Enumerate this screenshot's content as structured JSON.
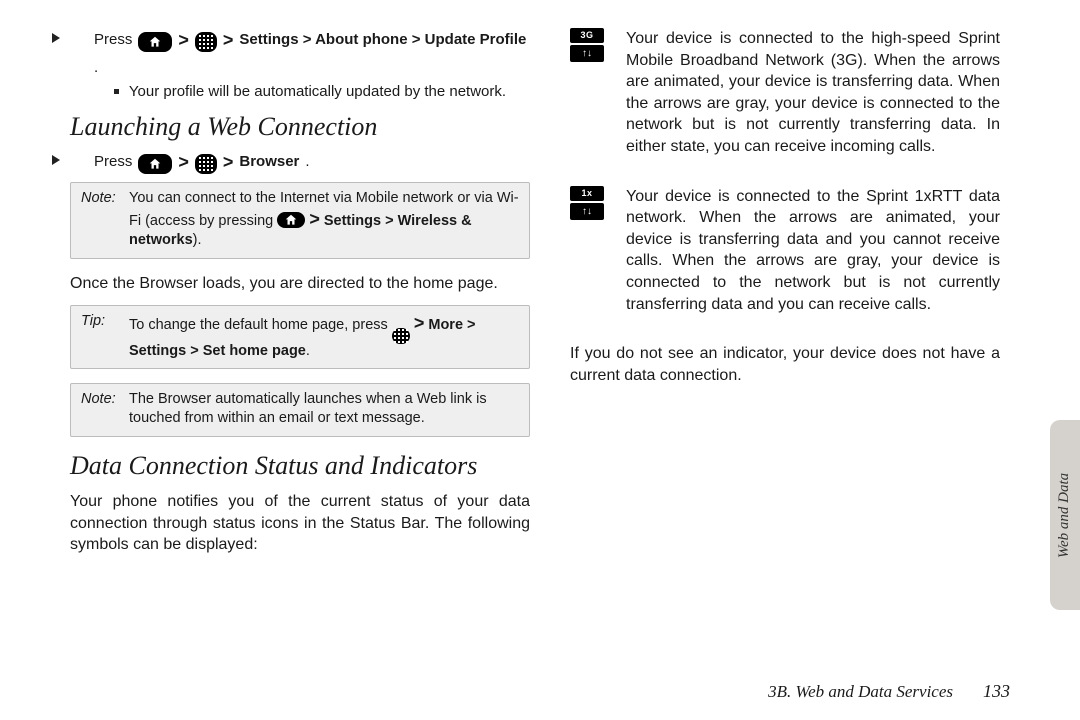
{
  "left": {
    "step1": {
      "prefix": "Press",
      "path": "Settings > About phone > Update Profile",
      "sub": "Your profile will be automatically updated by the network."
    },
    "h_launch": "Launching a Web Connection",
    "step2": {
      "prefix": "Press",
      "path": "Browser"
    },
    "note1": {
      "label": "Note:",
      "body_pre": "You can connect to the Internet via Mobile network or via Wi-Fi (access by pressing ",
      "path": "Settings > Wireless & networks",
      "body_post": ")."
    },
    "para1": "Once the Browser loads, you are directed to the home page.",
    "tip": {
      "label": "Tip:",
      "body_pre": "To change the default home page, press ",
      "path": "More > Settings > Set home page",
      "body_post": "."
    },
    "note2": {
      "label": "Note:",
      "body": "The Browser automatically launches when a Web link is touched from within an email or text message."
    },
    "h_status": "Data Connection Status and Indicators",
    "para2": "Your phone notifies you of the current status of your data connection through status icons in the Status Bar. The following symbols can be displayed:"
  },
  "right": {
    "ind_3g": {
      "label": "3G",
      "text": "Your device is connected to the high-speed Sprint Mobile Broadband Network (3G). When the arrows are animated, your device is transferring data. When the arrows are gray, your device is connected to the network but is not currently transferring data. In either state, you can receive incoming calls."
    },
    "ind_1x": {
      "label": "1x",
      "text": "Your device is connected to the Sprint 1xRTT data network. When the arrows are animated, your device is transferring data and you cannot receive calls. When the arrows are gray, your device is connected to the network but is not currently transferring data and you can receive calls."
    },
    "para3": "If you do not see an indicator, your device does not have a current data connection."
  },
  "tab": "Web and Data",
  "footer": {
    "section": "3B. Web and Data Services",
    "page": "133"
  }
}
